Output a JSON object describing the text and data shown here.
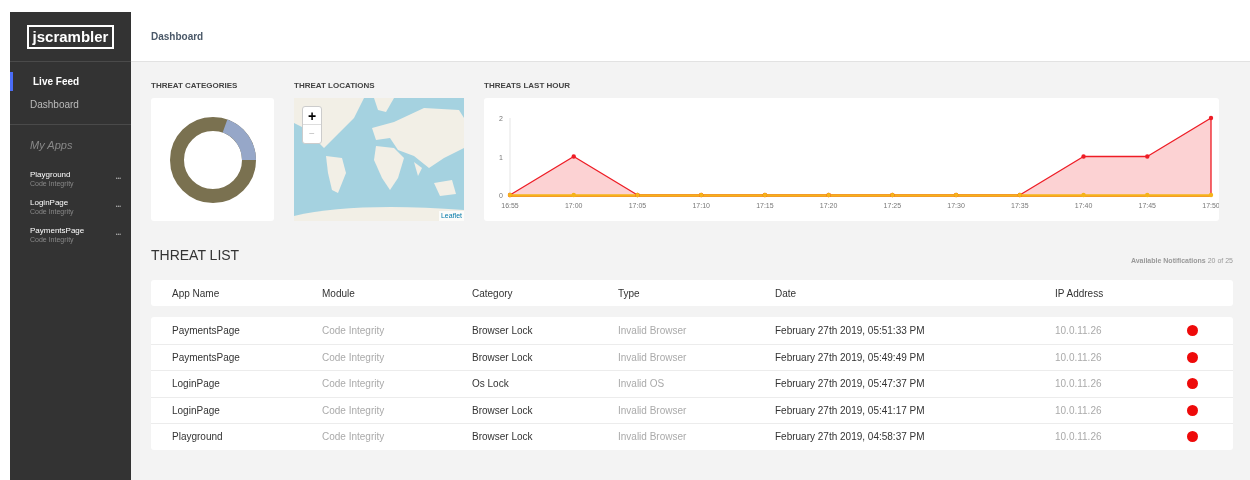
{
  "sidebar": {
    "logo": "jscrambler",
    "nav": [
      {
        "label": "Live Feed",
        "selected": true
      },
      {
        "label": "Dashboard",
        "selected": false
      }
    ],
    "apps_title": "My Apps",
    "apps": [
      {
        "name": "Playground",
        "module": "Code Integrity",
        "menu": "•••"
      },
      {
        "name": "LoginPage",
        "module": "Code Integrity",
        "menu": "•••"
      },
      {
        "name": "PaymentsPage",
        "module": "Code Integrity",
        "menu": "•••"
      }
    ]
  },
  "header": {
    "breadcrumb": "Dashboard"
  },
  "threat_categories": {
    "title": "THREAT CATEGORIES"
  },
  "threat_locations": {
    "title": "THREAT LOCATIONS",
    "zoom_in": "+",
    "zoom_out": "−",
    "attribution": "Leaflet"
  },
  "threats_last_hour": {
    "title": "THREATS LAST HOUR",
    "chart_data": {
      "type": "area",
      "categories": [
        "16:55",
        "17:00",
        "17:05",
        "17:10",
        "17:15",
        "17:20",
        "17:25",
        "17:30",
        "17:35",
        "17:40",
        "17:45",
        "17:50"
      ],
      "yticks": [
        0,
        1,
        2
      ],
      "ylim": [
        0,
        2
      ],
      "series": [
        {
          "color": "#ee1c25",
          "values": [
            0,
            1,
            0,
            0,
            0,
            0,
            0,
            0,
            0,
            1,
            1,
            2
          ]
        },
        {
          "color": "#f5b31a",
          "values": [
            0,
            0,
            0,
            0,
            0,
            0,
            0,
            0,
            0,
            0,
            0,
            0
          ]
        }
      ]
    }
  },
  "threat_list": {
    "title": "THREAT LIST",
    "notifications_label": "Available Notifications",
    "notifications_count": "20 of 25",
    "columns": [
      "App Name",
      "Module",
      "Category",
      "Type",
      "Date",
      "IP Address"
    ],
    "rows": [
      {
        "cells": [
          "PaymentsPage",
          "Code Integrity",
          "Browser Lock",
          "Invalid Browser",
          "February 27th 2019, 05:51:33 PM",
          "10.0.11.26"
        ],
        "color": "#ee0a0a"
      },
      {
        "cells": [
          "PaymentsPage",
          "Code Integrity",
          "Browser Lock",
          "Invalid Browser",
          "February 27th 2019, 05:49:49 PM",
          "10.0.11.26"
        ],
        "color": "#ee0a0a"
      },
      {
        "cells": [
          "LoginPage",
          "Code Integrity",
          "Os Lock",
          "Invalid OS",
          "February 27th 2019, 05:47:37 PM",
          "10.0.11.26"
        ],
        "color": "#ee0a0a"
      },
      {
        "cells": [
          "LoginPage",
          "Code Integrity",
          "Browser Lock",
          "Invalid Browser",
          "February 27th 2019, 05:41:17 PM",
          "10.0.11.26"
        ],
        "color": "#ee0a0a"
      },
      {
        "cells": [
          "Playground",
          "Code Integrity",
          "Browser Lock",
          "Invalid Browser",
          "February 27th 2019, 04:58:37 PM",
          "10.0.11.26"
        ],
        "color": "#ee0a0a"
      }
    ]
  }
}
